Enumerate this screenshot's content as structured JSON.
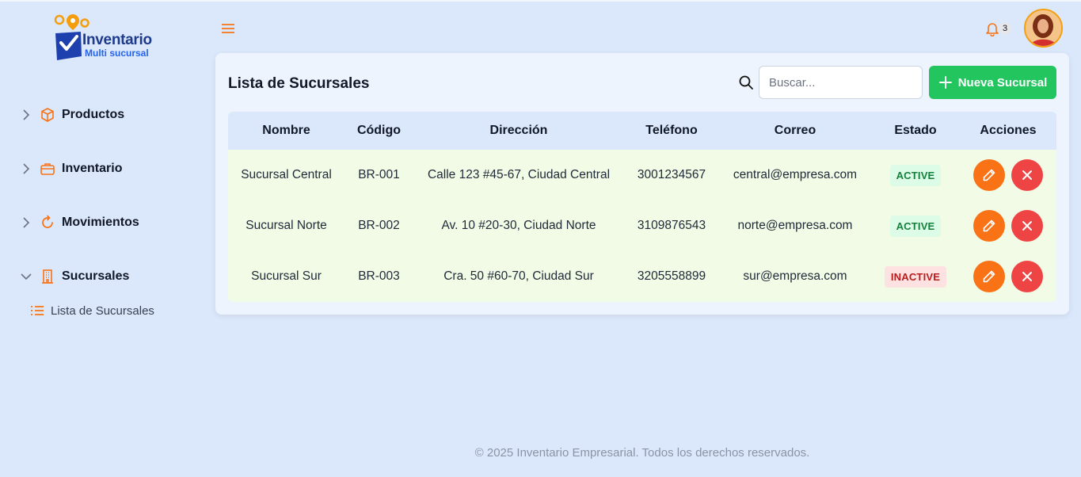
{
  "logo": {
    "title": "Inventario",
    "subtitle": "Multi sucursal"
  },
  "sidebar": {
    "items": [
      {
        "label": "Productos",
        "icon": "box-icon",
        "expanded": false
      },
      {
        "label": "Inventario",
        "icon": "briefcase-icon",
        "expanded": false
      },
      {
        "label": "Movimientos",
        "icon": "refresh-icon",
        "expanded": false
      },
      {
        "label": "Sucursales",
        "icon": "building-icon",
        "expanded": true
      }
    ],
    "subitems": [
      {
        "label": "Lista de Sucursales",
        "icon": "list-icon"
      }
    ]
  },
  "topbar": {
    "notification_count": "3"
  },
  "card": {
    "title": "Lista de Sucursales",
    "search_placeholder": "Buscar...",
    "new_button": "Nueva Sucursal"
  },
  "table": {
    "headers": [
      "Nombre",
      "Código",
      "Dirección",
      "Teléfono",
      "Correo",
      "Estado",
      "Acciones"
    ],
    "rows": [
      {
        "nombre": "Sucursal Central",
        "codigo": "BR-001",
        "direccion": "Calle 123 #45-67, Ciudad Central",
        "telefono": "3001234567",
        "correo": "central@empresa.com",
        "estado": "ACTIVE"
      },
      {
        "nombre": "Sucursal Norte",
        "codigo": "BR-002",
        "direccion": "Av. 10 #20-30, Ciudad Norte",
        "telefono": "3109876543",
        "correo": "norte@empresa.com",
        "estado": "ACTIVE"
      },
      {
        "nombre": "Sucursal Sur",
        "codigo": "BR-003",
        "direccion": "Cra. 50 #60-70, Ciudad Sur",
        "telefono": "3205558899",
        "correo": "sur@empresa.com",
        "estado": "INACTIVE"
      }
    ]
  },
  "footer": {
    "text": "© 2025 Inventario Empresarial. Todos los derechos reservados."
  },
  "colors": {
    "accent": "#f97316",
    "success": "#22c55e",
    "danger": "#ef4444",
    "background": "#dbe8fb"
  }
}
